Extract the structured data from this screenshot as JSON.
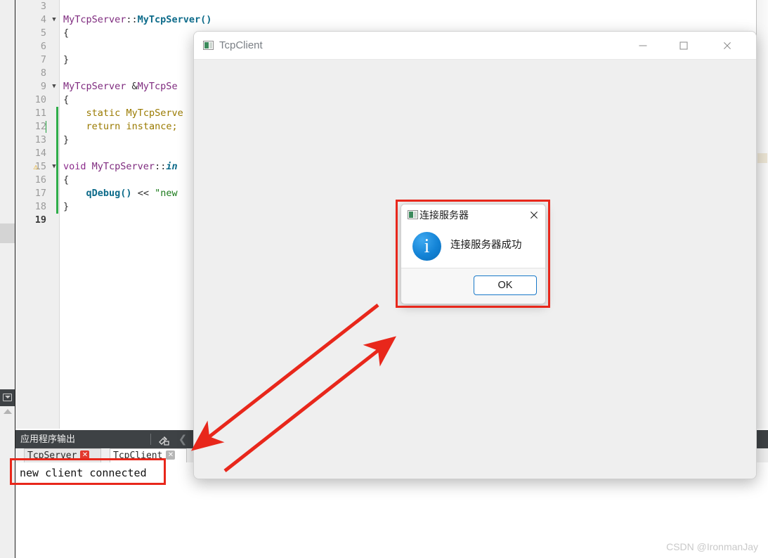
{
  "ide": {
    "editor": {
      "language": "C++",
      "lines": [
        {
          "num": "3",
          "fold": false,
          "warn": false,
          "change": false,
          "tokens": []
        },
        {
          "num": "4",
          "fold": true,
          "warn": false,
          "change": false,
          "tokens": [
            {
              "t": "MyTcpServer",
              "c": "tok-class"
            },
            {
              "t": "::",
              "c": "tok-plain"
            },
            {
              "t": "MyTcpServer()",
              "c": "tok-func"
            }
          ]
        },
        {
          "num": "5",
          "fold": false,
          "warn": false,
          "change": false,
          "tokens": [
            {
              "t": "{",
              "c": "tok-plain"
            }
          ]
        },
        {
          "num": "6",
          "fold": false,
          "warn": false,
          "change": false,
          "tokens": []
        },
        {
          "num": "7",
          "fold": false,
          "warn": false,
          "change": false,
          "tokens": [
            {
              "t": "}",
              "c": "tok-plain"
            }
          ]
        },
        {
          "num": "8",
          "fold": false,
          "warn": false,
          "change": false,
          "tokens": []
        },
        {
          "num": "9",
          "fold": true,
          "warn": false,
          "change": false,
          "tokens": [
            {
              "t": "MyTcpServer",
              "c": "tok-class"
            },
            {
              "t": " &",
              "c": "tok-plain"
            },
            {
              "t": "MyTcpSe",
              "c": "tok-class"
            }
          ]
        },
        {
          "num": "10",
          "fold": false,
          "warn": false,
          "change": false,
          "tokens": [
            {
              "t": "{",
              "c": "tok-plain"
            }
          ]
        },
        {
          "num": "11",
          "fold": false,
          "warn": false,
          "change": true,
          "tokens": [
            {
              "t": "    ",
              "c": "tok-plain"
            },
            {
              "t": "static",
              "c": "tok-type"
            },
            {
              "t": " ",
              "c": "tok-plain"
            },
            {
              "t": "MyTcpServe",
              "c": "tok-type"
            }
          ]
        },
        {
          "num": "12",
          "fold": false,
          "warn": false,
          "change": true,
          "caret": true,
          "tokens": [
            {
              "t": "    ",
              "c": "tok-plain"
            },
            {
              "t": "return",
              "c": "tok-type"
            },
            {
              "t": " ",
              "c": "tok-plain"
            },
            {
              "t": "instance;",
              "c": "tok-type"
            }
          ]
        },
        {
          "num": "13",
          "fold": false,
          "warn": false,
          "change": true,
          "tokens": [
            {
              "t": "}",
              "c": "tok-plain"
            }
          ]
        },
        {
          "num": "14",
          "fold": false,
          "warn": false,
          "change": true,
          "tokens": []
        },
        {
          "num": "15",
          "fold": true,
          "warn": true,
          "change": true,
          "tokens": [
            {
              "t": "void",
              "c": "tok-kw"
            },
            {
              "t": " ",
              "c": "tok-plain"
            },
            {
              "t": "MyTcpServer",
              "c": "tok-class"
            },
            {
              "t": "::",
              "c": "tok-plain"
            },
            {
              "t": "in",
              "c": "tok-italic"
            }
          ]
        },
        {
          "num": "16",
          "fold": false,
          "warn": false,
          "change": true,
          "tokens": [
            {
              "t": "{",
              "c": "tok-plain"
            }
          ]
        },
        {
          "num": "17",
          "fold": false,
          "warn": false,
          "change": true,
          "tokens": [
            {
              "t": "    ",
              "c": "tok-plain"
            },
            {
              "t": "qDebug()",
              "c": "tok-func"
            },
            {
              "t": " ",
              "c": "tok-plain"
            },
            {
              "t": "<<",
              "c": "tok-op"
            },
            {
              "t": " ",
              "c": "tok-plain"
            },
            {
              "t": "\"new",
              "c": "tok-str"
            }
          ]
        },
        {
          "num": "18",
          "fold": false,
          "warn": false,
          "change": true,
          "tokens": [
            {
              "t": "}",
              "c": "tok-plain"
            }
          ]
        },
        {
          "num": "19",
          "fold": false,
          "warn": false,
          "change": false,
          "current": true,
          "tokens": []
        }
      ]
    },
    "output_panel": {
      "title": "应用程序输出",
      "clear_icon": "broom-icon",
      "prev_icon": "chevron-left-icon",
      "next_icon": "chevron-right-icon",
      "tabs": [
        {
          "label": "TcpServer",
          "close_state": "running",
          "active": false
        },
        {
          "label": "TcpClient",
          "close_state": "stopped",
          "active": true
        }
      ],
      "log_text": "new client connected"
    },
    "sidebar": {
      "collapse_icon": "panel-toggle-icon",
      "expand_icon": "triangle-up-icon"
    }
  },
  "tcp_client_window": {
    "app_icon": "qt-app-icon",
    "title": "TcpClient",
    "controls": {
      "minimize": "minimize-icon",
      "maximize": "maximize-icon",
      "close": "close-icon"
    }
  },
  "message_box": {
    "app_icon": "qt-app-icon",
    "title": "连接服务器",
    "close": "close-icon",
    "severity_icon": "info-icon",
    "severity_glyph": "i",
    "message": "连接服务器成功",
    "ok_label": "OK"
  },
  "annotations": {
    "highlight_color": "#e8271b",
    "arrow_color": "#e8271b",
    "boxes": [
      {
        "name": "message-box-highlight"
      },
      {
        "name": "output-log-highlight"
      }
    ],
    "arrows": [
      {
        "name": "arrow-dialog-to-output",
        "direction": "down-left"
      },
      {
        "name": "arrow-output-to-dialog",
        "direction": "up-right"
      }
    ]
  },
  "watermark": "CSDN @IronmanJay"
}
